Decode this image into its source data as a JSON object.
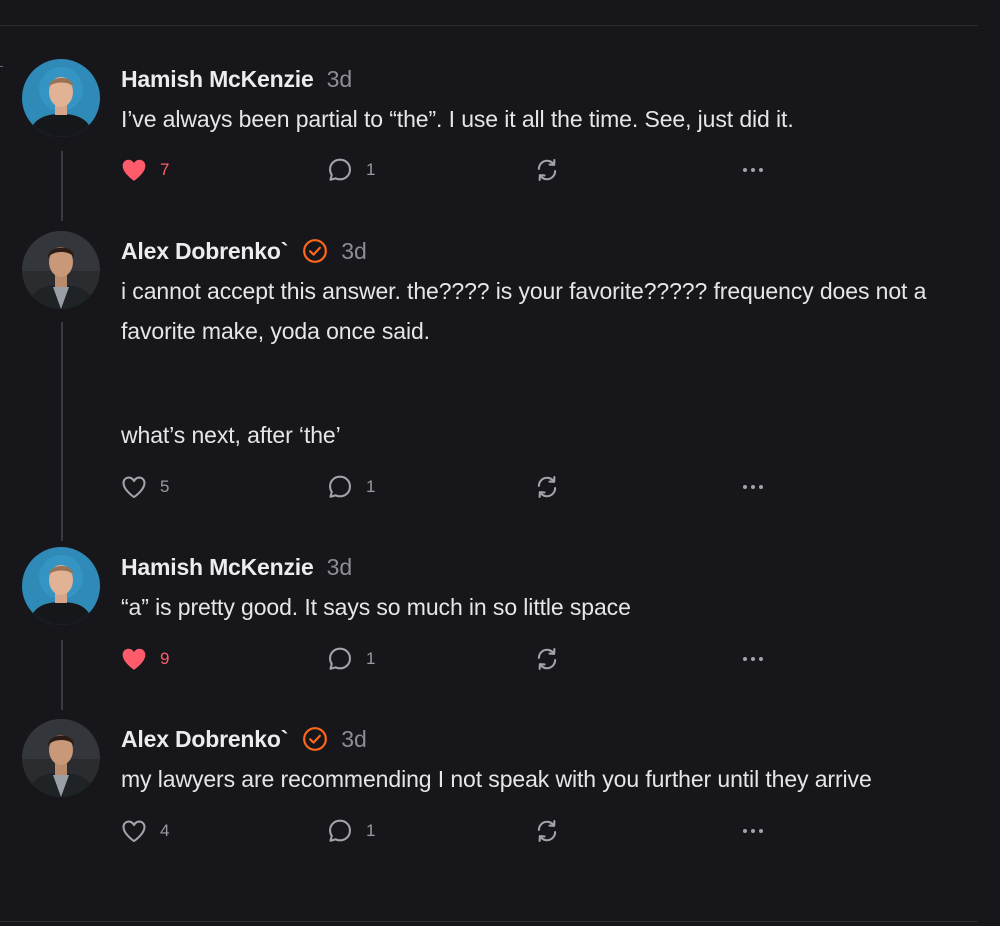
{
  "thread": {
    "comments": [
      {
        "author": "Hamish McKenzie",
        "verified": false,
        "time": "3d",
        "paragraphs": [
          "I’ve always been partial to “the”. I use it all the time. See, just did it."
        ],
        "likes": "7",
        "liked": true,
        "replies": "1",
        "avatar": "hamish"
      },
      {
        "author": "Alex Dobrenko`",
        "verified": true,
        "time": "3d",
        "paragraphs": [
          "i cannot accept this answer. the???? is your favorite????? frequency does not a favorite make, yoda once said.",
          "what’s next, after ‘the’"
        ],
        "likes": "5",
        "liked": false,
        "replies": "1",
        "avatar": "alex"
      },
      {
        "author": "Hamish McKenzie",
        "verified": false,
        "time": "3d",
        "paragraphs": [
          "“a” is pretty good. It says so much in so little space"
        ],
        "likes": "9",
        "liked": true,
        "replies": "1",
        "avatar": "hamish"
      },
      {
        "author": "Alex Dobrenko`",
        "verified": true,
        "time": "3d",
        "paragraphs": [
          "my lawyers are recommending I not speak with you further until they arrive"
        ],
        "likes": "4",
        "liked": false,
        "replies": "1",
        "avatar": "alex"
      }
    ]
  },
  "icons": {
    "like": "heart-icon",
    "reply": "comment-bubble-icon",
    "restack": "restack-icon",
    "more": "ellipsis-icon",
    "verified": "verified-check-icon"
  },
  "colors": {
    "background": "#17171b",
    "liked": "#ff5b6b",
    "verified": "#ff6719",
    "muted": "#8d8d94",
    "text": "#e6e6e8"
  }
}
